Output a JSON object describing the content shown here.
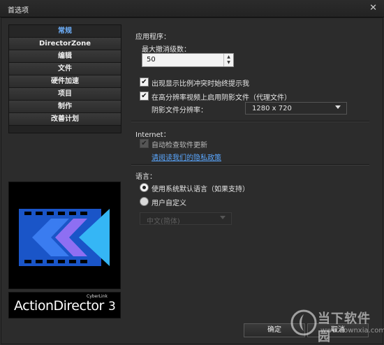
{
  "window": {
    "title": "首选项",
    "close_glyph": "✕"
  },
  "nav": {
    "items": [
      {
        "label": "常规",
        "active": true
      },
      {
        "label": "DirectorZone",
        "active": false
      },
      {
        "label": "编辑",
        "active": false
      },
      {
        "label": "文件",
        "active": false
      },
      {
        "label": "硬件加速",
        "active": false
      },
      {
        "label": "项目",
        "active": false
      },
      {
        "label": "制作",
        "active": false
      },
      {
        "label": "改善计划",
        "active": false
      }
    ]
  },
  "brand": {
    "name": "ActionDirector",
    "version": "3",
    "maker": "CyberLink"
  },
  "app_section": {
    "label": "应用程序：",
    "undo_label": "最大撤消级数：",
    "undo_value": "50",
    "option1": {
      "label": "出现显示比例冲突时始终提示我",
      "checked": true
    },
    "option2": {
      "label": "在高分辨率视频上启用阴影文件（代理文件）",
      "checked": true
    },
    "shadow_res_label": "阴影文件分辨率：",
    "shadow_res_value": "1280 x 720"
  },
  "internet_section": {
    "label": "Internet：",
    "auto_update": {
      "label": "自动检查软件更新",
      "checked": true,
      "disabled": true
    },
    "privacy_link": "请阅读我们的隐私政策"
  },
  "language_section": {
    "label": "语言：",
    "use_default": "使用系统默认语言（如果支持）",
    "user_defined": "用户自定义",
    "selected_language": "中文(简体)"
  },
  "footer": {
    "ok_label": "确定",
    "cancel_label": "取消"
  },
  "watermark": {
    "text": "当下软件园",
    "url": "www.downxia.com"
  },
  "colors": {
    "accent": "#5aa7ff",
    "background": "#2f2f2f",
    "nav_active": "#6fb2ff"
  }
}
